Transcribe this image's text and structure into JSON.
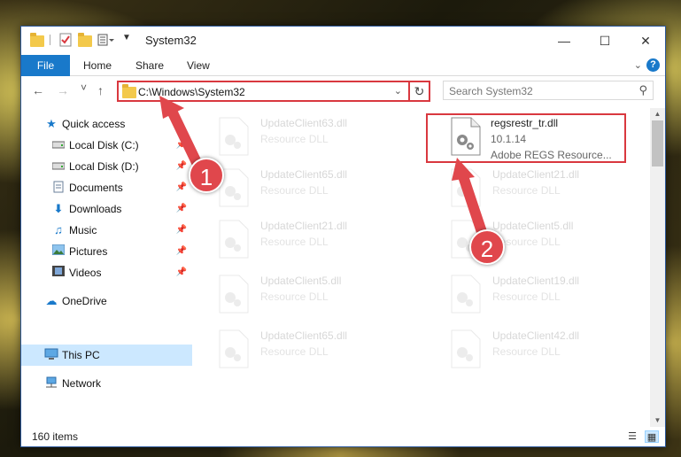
{
  "window": {
    "title": "System32",
    "controls": {
      "minimize": "—",
      "maximize": "☐",
      "close": "✕"
    }
  },
  "ribbon": {
    "tabs": [
      "File",
      "Home",
      "Share",
      "View"
    ],
    "collapse_icon": "chevron-down-icon",
    "help_label": "?"
  },
  "nav": {
    "back": "←",
    "forward": "→",
    "recent": "˅",
    "up": "↑",
    "address": "C:\\Windows\\System32",
    "search_placeholder": "Search System32"
  },
  "sidebar": {
    "items": [
      {
        "label": "Quick access",
        "icon": "star-icon",
        "pinned": false
      },
      {
        "label": "Local Disk (C:)",
        "icon": "drive-icon",
        "pinned": true
      },
      {
        "label": "Local Disk (D:)",
        "icon": "drive-icon",
        "pinned": true
      },
      {
        "label": "Documents",
        "icon": "documents-icon",
        "pinned": true
      },
      {
        "label": "Downloads",
        "icon": "download-icon",
        "pinned": true
      },
      {
        "label": "Music",
        "icon": "music-icon",
        "pinned": true
      },
      {
        "label": "Pictures",
        "icon": "pictures-icon",
        "pinned": true
      },
      {
        "label": "Videos",
        "icon": "videos-icon",
        "pinned": true
      },
      {
        "label": "OneDrive",
        "icon": "cloud-icon",
        "pinned": false
      },
      {
        "label": "This PC",
        "icon": "computer-icon",
        "pinned": false,
        "selected": true
      },
      {
        "label": "Network",
        "icon": "network-icon",
        "pinned": false
      }
    ]
  },
  "files": [
    {
      "name": "UpdateClient63.dll",
      "type": "Resource DLL",
      "faded": true
    },
    {
      "name": "regsrestr_tr.dll",
      "version": "10.1.14",
      "type": "Adobe REGS Resource...",
      "faded": false,
      "highlighted": true
    },
    {
      "name": "UpdateClient65.dll",
      "type": "Resource DLL",
      "faded": true
    },
    {
      "name": "UpdateClient21.dll",
      "type": "Resource DLL",
      "faded": true
    },
    {
      "name": "UpdateClient21.dll",
      "type": "Resource DLL",
      "faded": true
    },
    {
      "name": "UpdateClient5.dll",
      "type": "Resource DLL",
      "faded": true
    },
    {
      "name": "UpdateClient5.dll",
      "type": "Resource DLL",
      "faded": true
    },
    {
      "name": "UpdateClient19.dll",
      "type": "Resource DLL",
      "faded": true
    },
    {
      "name": "UpdateClient65.dll",
      "type": "Resource DLL",
      "faded": true
    },
    {
      "name": "UpdateClient42.dll",
      "type": "Resource DLL",
      "faded": true
    }
  ],
  "status": {
    "item_count": "160 items"
  },
  "annotations": {
    "step1": "1",
    "step2": "2",
    "color": "#e0474c"
  }
}
